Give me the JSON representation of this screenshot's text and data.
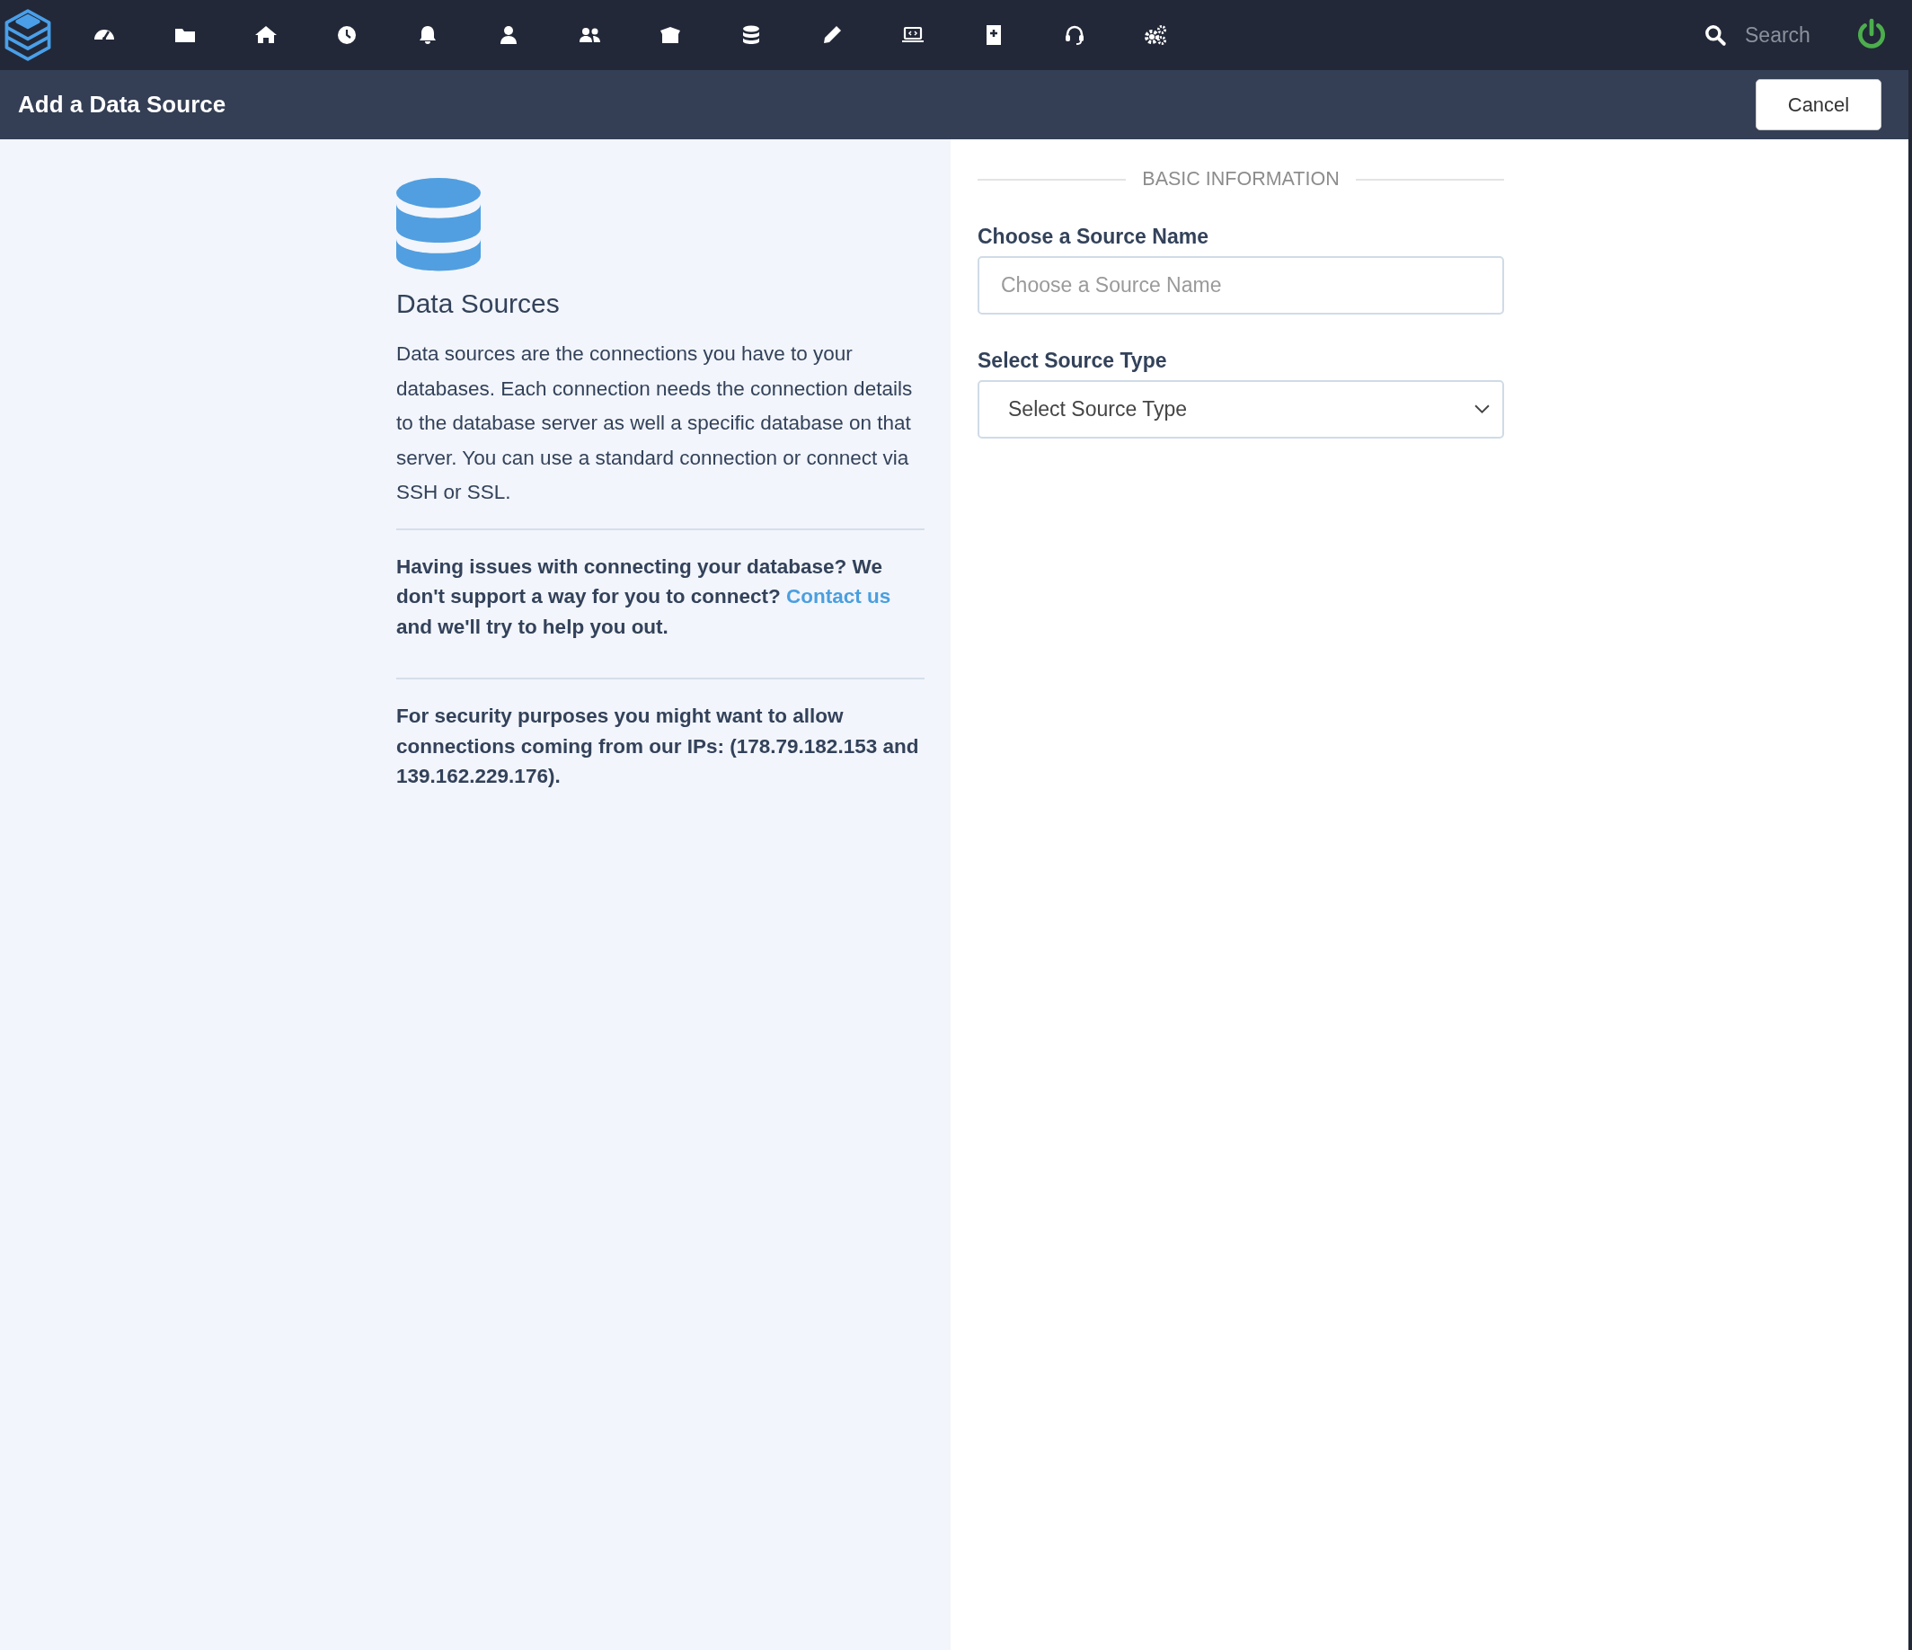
{
  "top_bar": {
    "search": {
      "placeholder": "Search"
    }
  },
  "page_header": {
    "title": "Add a Data Source",
    "cancel_button": "Cancel"
  },
  "info_panel": {
    "title": "Data Sources",
    "description": "Data sources are the connections you have to your databases. Each connection needs the connection details to the database server as well a specific database on that server. You can use a standard connection or connect via SSH or SSL.",
    "help": {
      "before": "Having issues with connecting your database? We don't support a way for you to connect?",
      "link": "Contact us",
      "after": "and we'll try to help you out."
    },
    "security_note": "For security purposes you might want to allow connections coming from our IPs: (178.79.182.153 and 139.162.229.176)."
  },
  "form": {
    "section_title": "BASIC INFORMATION",
    "fields": [
      {
        "kind": "text",
        "label": "Choose a Source Name",
        "placeholder": "Choose a Source Name"
      },
      {
        "kind": "select",
        "label": "Select Source Type",
        "value": "Select Source Type"
      }
    ]
  }
}
